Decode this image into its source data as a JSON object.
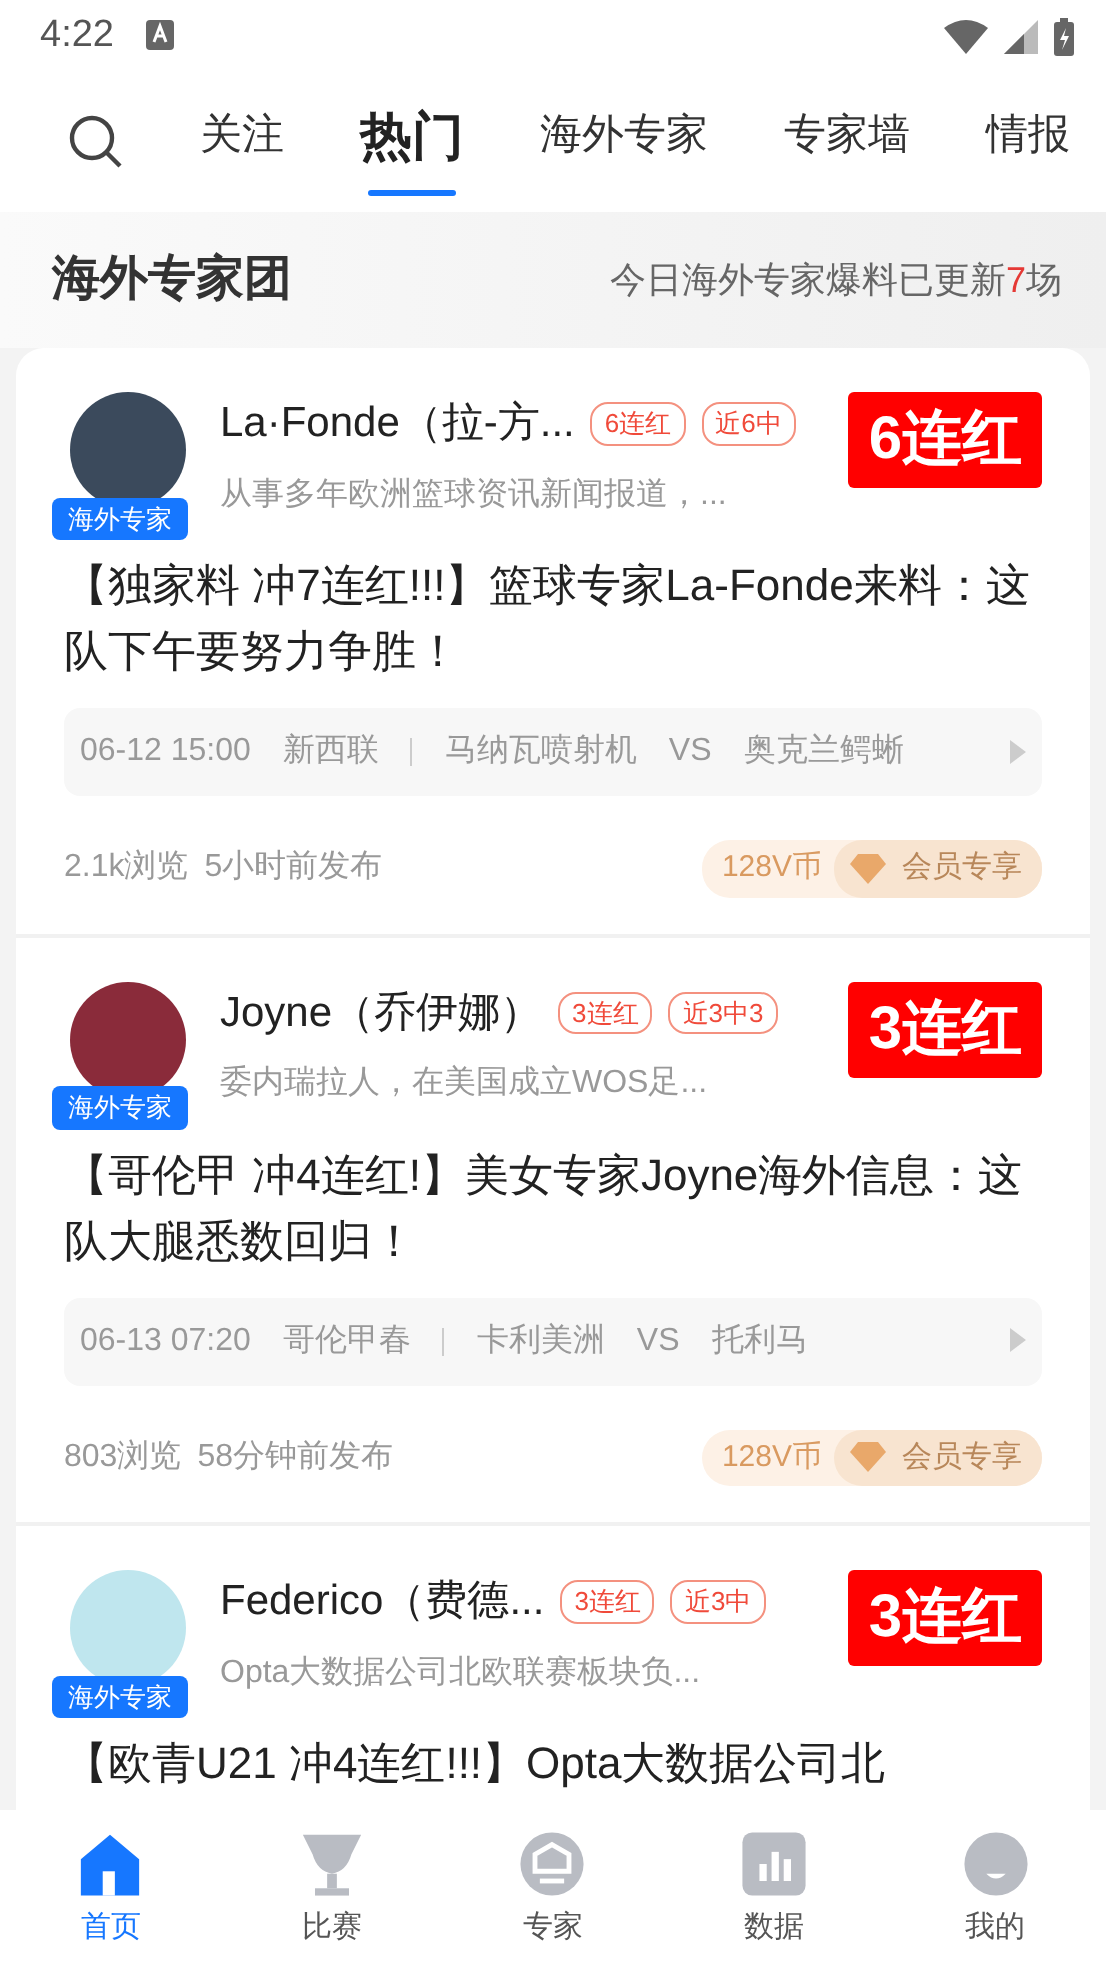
{
  "status_bar": {
    "time": "4:22"
  },
  "tabs": [
    {
      "label": "关注",
      "selected": false
    },
    {
      "label": "热门",
      "selected": true
    },
    {
      "label": "海外专家",
      "selected": false
    },
    {
      "label": "专家墙",
      "selected": false
    },
    {
      "label": "情报",
      "selected": false
    }
  ],
  "banner": {
    "title": "海外专家团",
    "update_prefix": "今日海外专家爆料已更新",
    "update_count": "7",
    "update_suffix": "场"
  },
  "posts": [
    {
      "name": "La·Fonde（拉-方...",
      "streak_tag": "6连红",
      "record_tag": "近6中",
      "stamp": "6连红",
      "badge": "海外专家",
      "bio": "从事多年欧洲篮球资讯新闻报道，...",
      "title": "【独家料 冲7连红!!!】篮球专家La-Fonde来料：这队下午要努力争胜！",
      "match": {
        "time": "06-12 15:00",
        "league": "新西联",
        "home": "马纳瓦喷射机",
        "vs": "VS",
        "away": "奥克兰鳄蜥"
      },
      "views": "2.1k浏览",
      "posted": "5小时前发布",
      "price": "128V币",
      "member_label": "会员专享"
    },
    {
      "name": "Joyne（乔伊娜）",
      "streak_tag": "3连红",
      "record_tag": "近3中3",
      "stamp": "3连红",
      "badge": "海外专家",
      "bio": "委内瑞拉人，在美国成立WOS足...",
      "title": "【哥伦甲 冲4连红!】美女专家Joyne海外信息：这队大腿悉数回归！",
      "match": {
        "time": "06-13 07:20",
        "league": "哥伦甲春",
        "home": "卡利美洲",
        "vs": "VS",
        "away": "托利马"
      },
      "views": "803浏览",
      "posted": "58分钟前发布",
      "price": "128V币",
      "member_label": "会员专享"
    },
    {
      "name": "Federico（费德...",
      "streak_tag": "3连红",
      "record_tag": "近3中",
      "stamp": "3连红",
      "badge": "海外专家",
      "bio": "Opta大数据公司北欧联赛板块负...",
      "title": "【欧青U21 冲4连红!!!】Opta大数据公司北"
    }
  ],
  "bottom_nav": [
    {
      "label": "首页",
      "selected": true
    },
    {
      "label": "比赛",
      "selected": false
    },
    {
      "label": "专家",
      "selected": false
    },
    {
      "label": "数据",
      "selected": false
    },
    {
      "label": "我的",
      "selected": false
    }
  ]
}
